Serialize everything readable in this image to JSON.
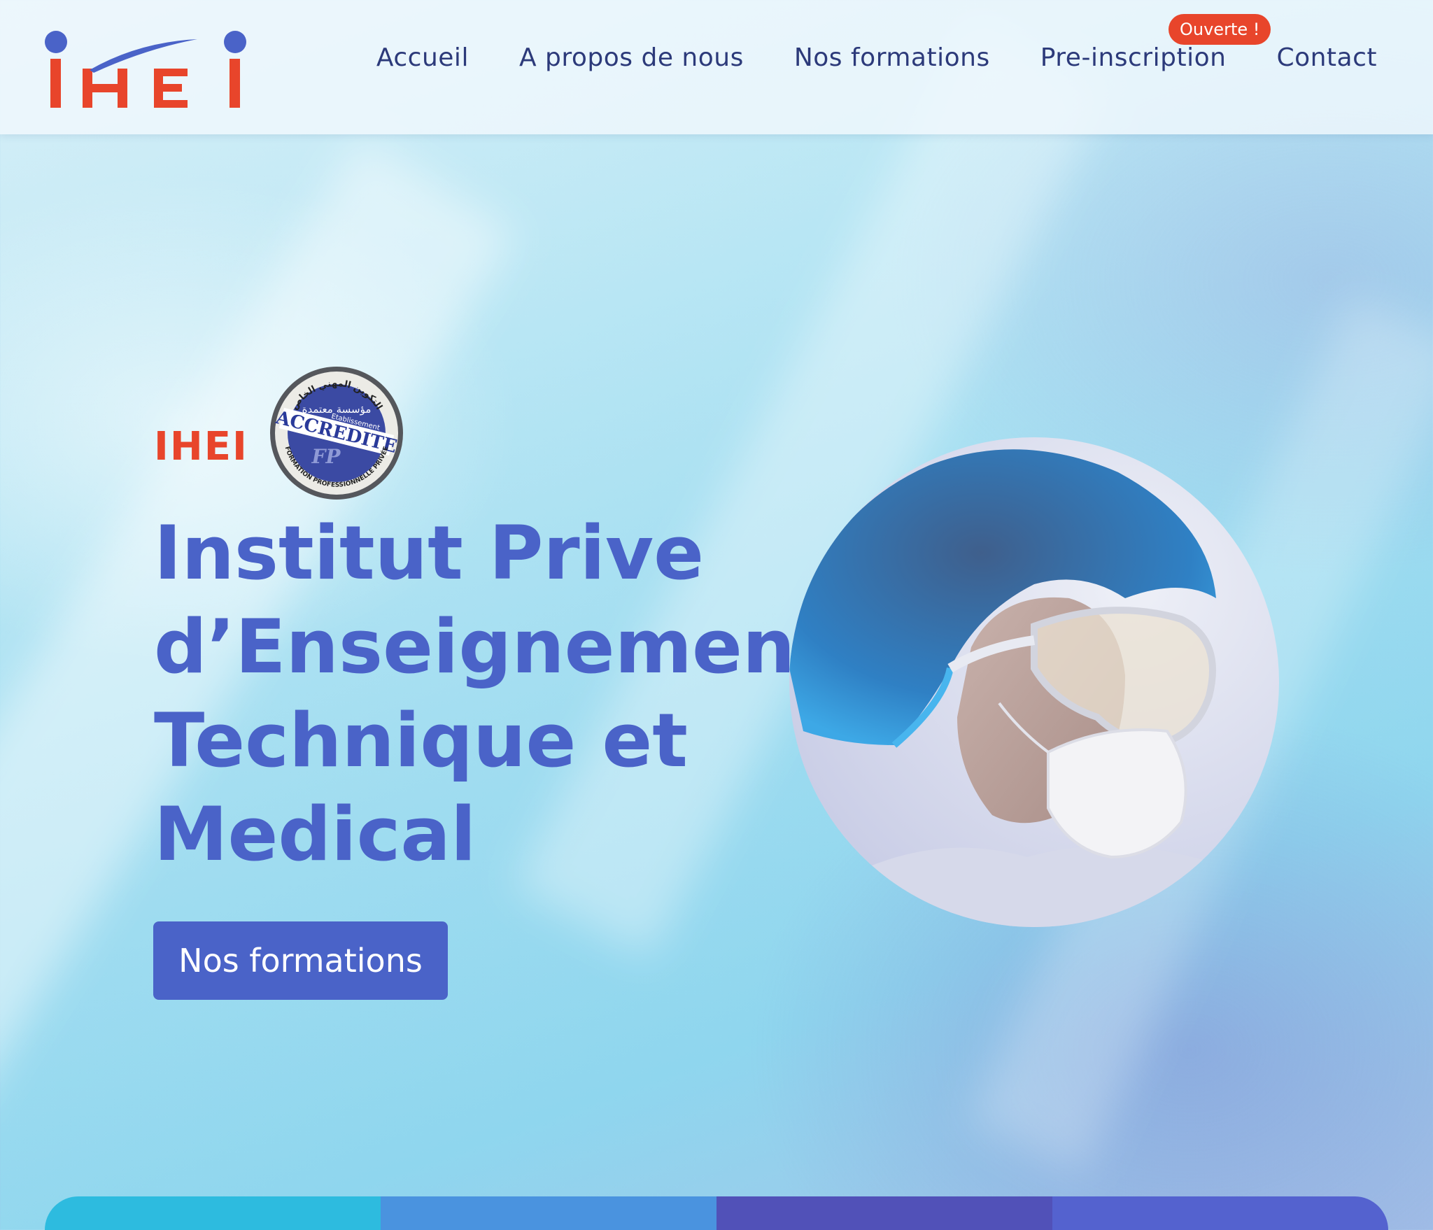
{
  "header": {
    "logo_text": "IHEI",
    "nav": [
      {
        "label": "Accueil"
      },
      {
        "label": "A propos de nous"
      },
      {
        "label": "Nos formations"
      },
      {
        "label": "Pre-inscription"
      },
      {
        "label": "Contact"
      }
    ],
    "badge": "Ouverte !"
  },
  "hero": {
    "brand": "IHEI",
    "seal": {
      "top_text": "التكوين المهني الخاص",
      "arabic_main": "مؤسسة معتمدة",
      "word": "ACCREDITE",
      "sub": "Etablissement",
      "mark": "FP",
      "bottom_text": "FORMATION PROFESSIONNELLE PRIVÉE"
    },
    "title_lines": [
      "Institut Prive",
      "d’Enseignement",
      "Technique et",
      "Medical"
    ],
    "cta_label": "Nos formations"
  },
  "colors": {
    "accent": "#4a63c8",
    "brand_red": "#e8452b",
    "nav_text": "#2c3a7a",
    "strip": [
      "#2dbbdf",
      "#4a93df",
      "#5151b8",
      "#5462cf"
    ]
  },
  "icons": {
    "logo": "ihei-logo",
    "seal": "accredited-seal-icon",
    "photo": "medical-worker-photo"
  }
}
